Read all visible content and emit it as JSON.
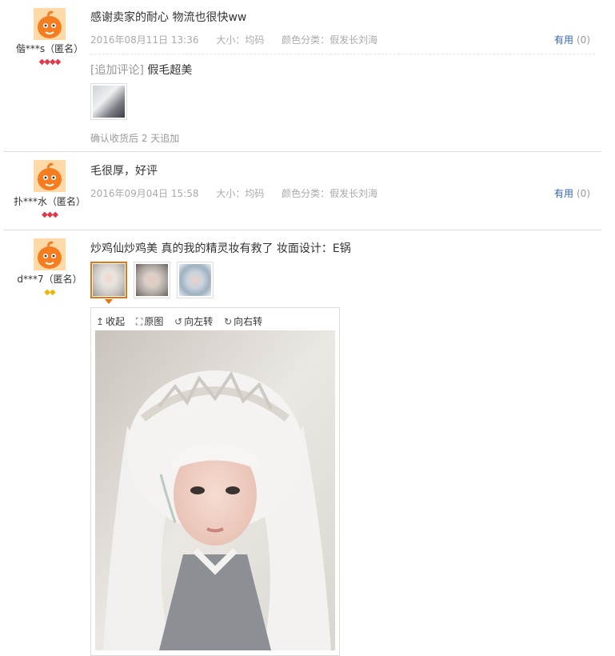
{
  "reviews": [
    {
      "username": "偕***s（匿名）",
      "gem_count": 4,
      "text": "感谢卖家的耐心 物流也很快ww",
      "date": "2016年08月11日 13:36",
      "size": "大小：均码",
      "color": "颜色分类：假发长刘海",
      "useful_label": "有用",
      "useful_count": "(0)",
      "append_label": "[追加评论]",
      "append_text": "假毛超美",
      "append_note": "确认收货后 2 天追加"
    },
    {
      "username": "扑***水（匿名）",
      "gem_count": 3,
      "text": "毛很厚，好评",
      "date": "2016年09月04日 15:58",
      "size": "大小：均码",
      "color": "颜色分类：假发长刘海",
      "useful_label": "有用",
      "useful_count": "(0)"
    },
    {
      "username": "d***7（匿名）",
      "gem_count": 2,
      "text": "炒鸡仙炒鸡美 真的我的精灵妆有救了 妆面设计：E锅",
      "viewer": {
        "collapse": "收起",
        "original": "原图",
        "rotate_left": "向左转",
        "rotate_right": "向右转"
      }
    }
  ],
  "colors": {
    "link": "#3366aa",
    "selected_border": "#e4750f",
    "gem_red": "#e03a4a",
    "gem_yellow": "#f0b400"
  }
}
